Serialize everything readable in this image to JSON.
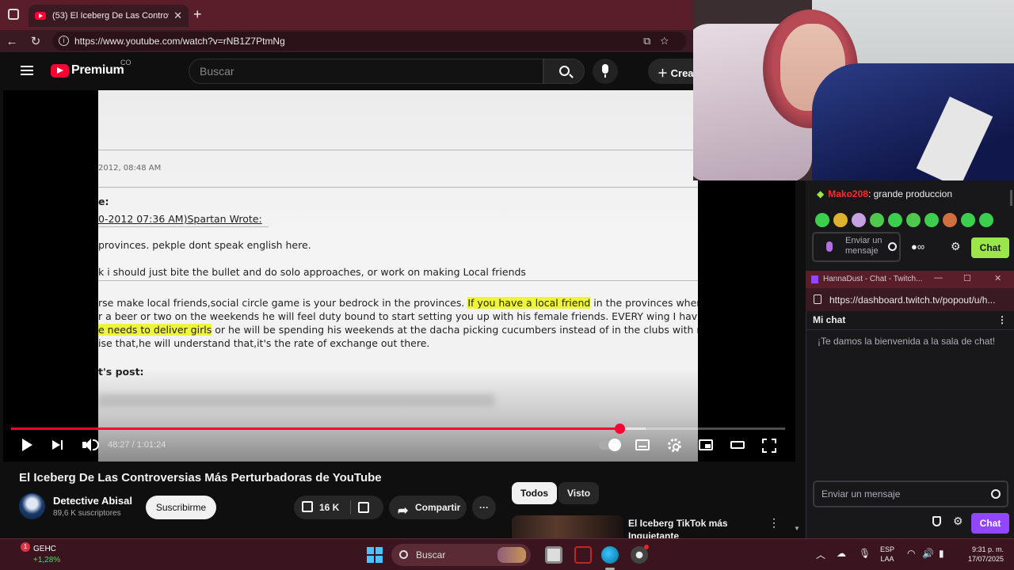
{
  "browser": {
    "tab_title": "(53) El Iceberg De Las Controversi",
    "url": "https://www.youtube.com/watch?v=rNB1Z7PtmNg"
  },
  "youtube": {
    "brand": "Premium",
    "brand_sup": "CO",
    "search_placeholder": "Buscar",
    "create_label": "Crea",
    "video": {
      "document_lines": [
        "2012, 08:48 AM",
        "e:",
        "0-2012 07:36 AM)Spartan Wrote:",
        "provinces. pekple dont speak english here.",
        "k i should just bite the bullet and do solo approaches, or work on making Local friends",
        "rse make local friends,social circle game is your bedrock in the provinces.",
        "If you have a local friend",
        "in the provinces where",
        "r a beer or two on the weekends he will feel duty bound to start setting you up with his female friends. EVERY wing I have h",
        "e needs to deliver girls",
        "or he will be spending his weekends at the dacha picking cucumbers instead of in the clubs with me.",
        "ise that,he will understand that,it's the rate of exchange out there.",
        "t's post:"
      ],
      "progress": 0.7865,
      "buffered": 0.82,
      "time": "48:27 / 1:01:24"
    },
    "title": "El Iceberg De Las Controversias Más Perturbadoras de YouTube",
    "channel": "Detective Abisal",
    "subscribers": "89,6 K suscriptores",
    "subscribe_label": "Suscribirme",
    "likes": "16 K",
    "share_label": "Compartir",
    "more_label": "···",
    "chips": [
      "Todos",
      "Visto"
    ],
    "rec_title": "El Iceberg TikTok más Inquietante"
  },
  "twitch_overlay": {
    "message_user": "Mako208",
    "message_text": ": grande produccion",
    "input_placeholder": "Enviar un mensaje",
    "chat_button": "Chat",
    "emote_colors": [
      "#3ccf4e",
      "#e0b030",
      "#c7a0e0",
      "#4ec94e",
      "#3ccf4e",
      "#4ec94e",
      "#3ccf4e",
      "#d07040",
      "#3ccf4e",
      "#3ccf4e"
    ]
  },
  "popout": {
    "window_title": "HannaDust - Chat - Twitch...",
    "url": "https://dashboard.twitch.tv/popout/u/h...",
    "header": "Mi chat",
    "welcome": "¡Te damos la bienvenida a la sala de chat!",
    "input_placeholder": "Enviar un mensaje",
    "chat_button": "Chat"
  },
  "taskbar": {
    "stock_badge": "1",
    "stock_name": "GEHC",
    "stock_change": "+1,28%",
    "search_label": "Buscar",
    "lang_top": "ESP",
    "lang_bottom": "LAA",
    "time": "9:31 p. m.",
    "date": "17/07/2025"
  },
  "colors": {
    "youtube_red": "#ff0033",
    "twitch_green": "#9ae64b",
    "twitch_purple": "#9147ff",
    "browser_frame": "#5a1d2a"
  }
}
